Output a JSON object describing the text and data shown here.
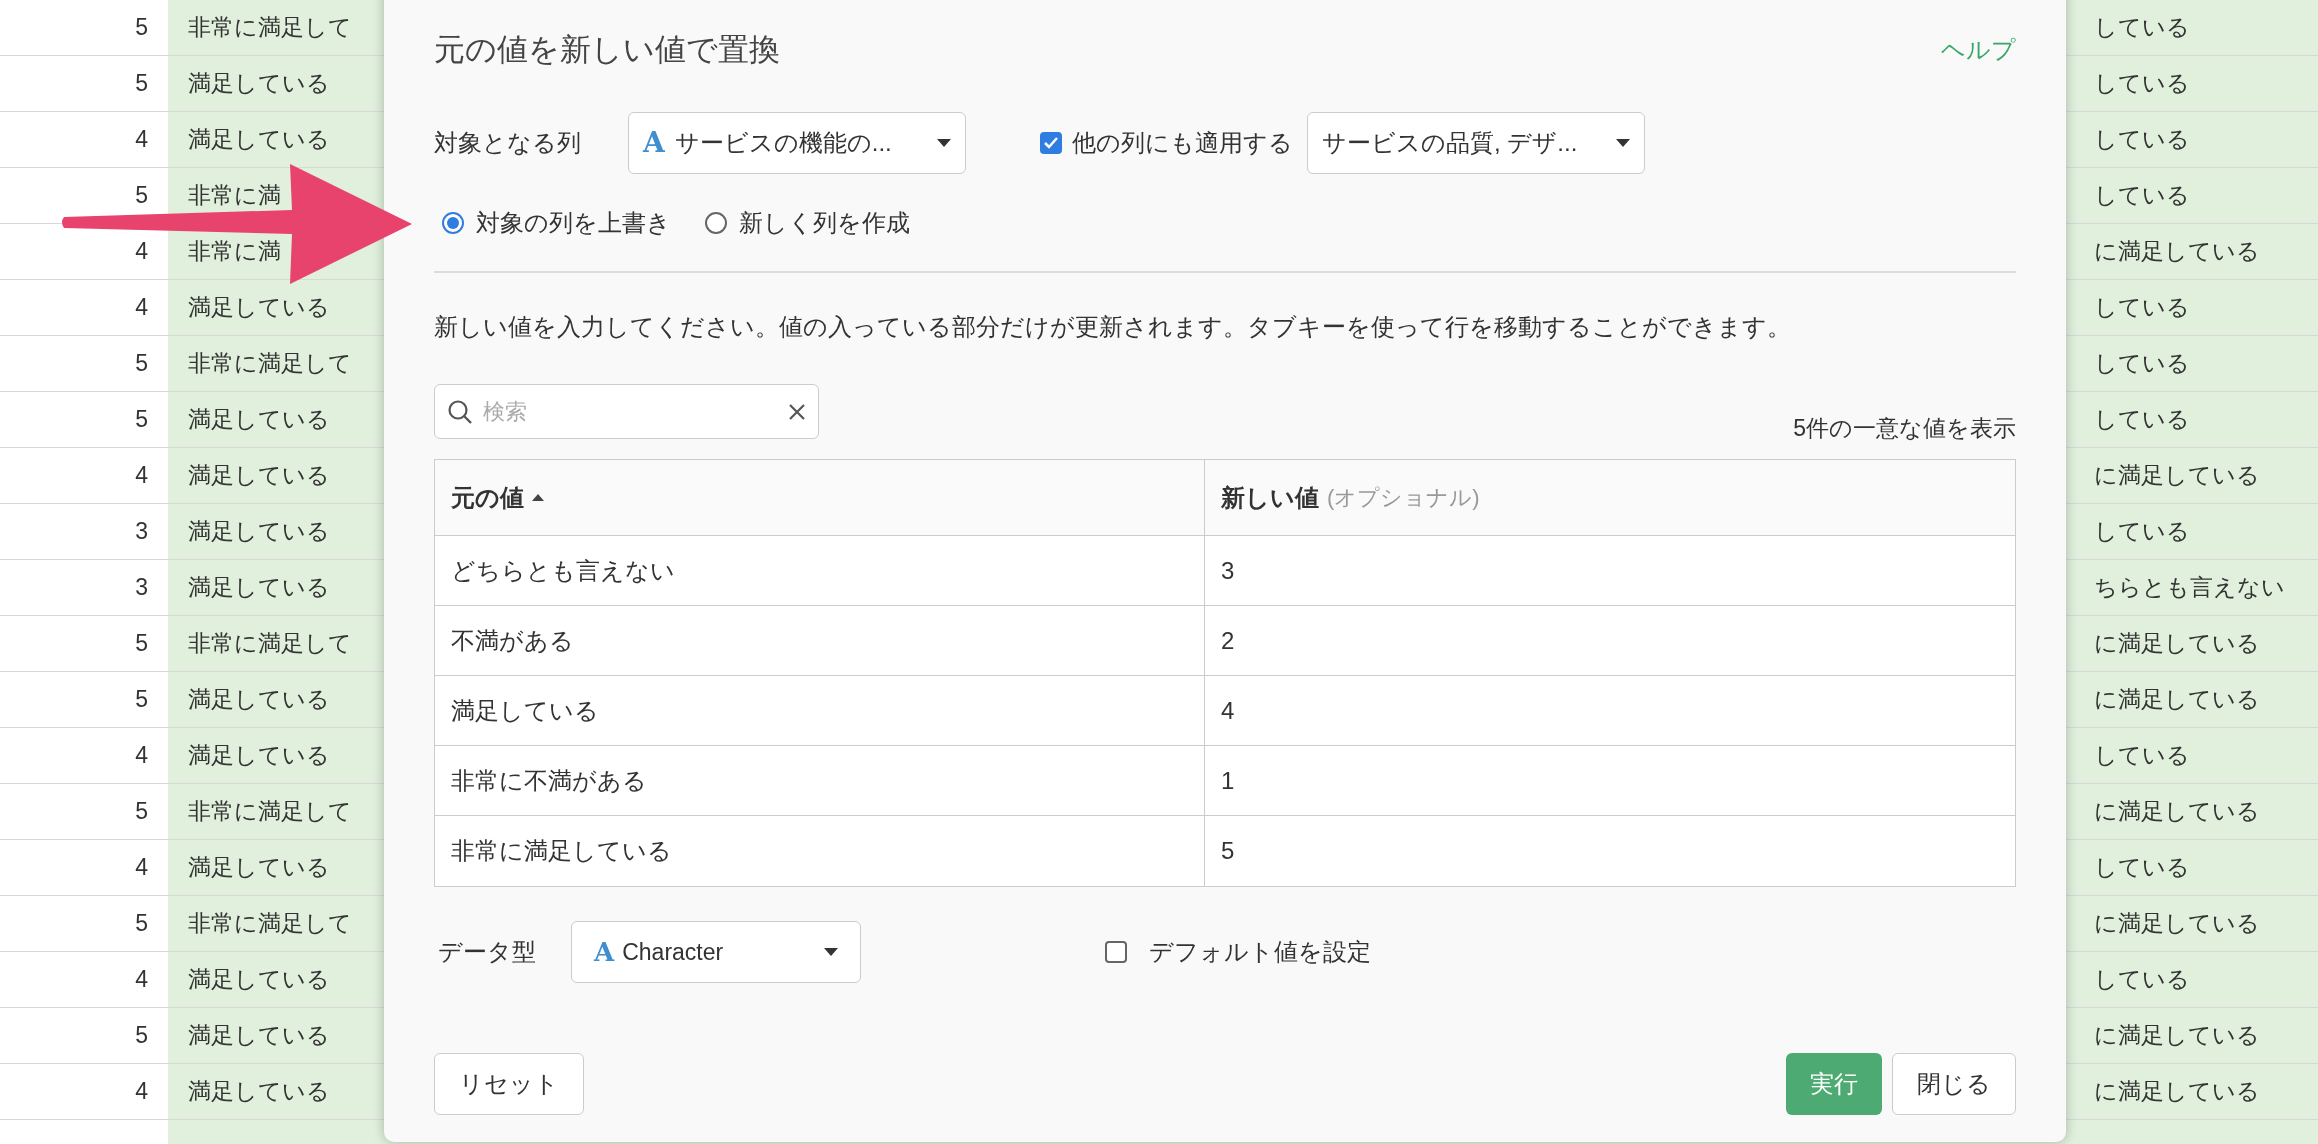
{
  "sheet": {
    "rows": [
      {
        "number": "5",
        "left_text": "非常に満足して",
        "right_text": "している"
      },
      {
        "number": "5",
        "left_text": "満足している",
        "right_text": "している"
      },
      {
        "number": "4",
        "left_text": "満足している",
        "right_text": "している"
      },
      {
        "number": "5",
        "left_text": "非常に満",
        "right_text": "している"
      },
      {
        "number": "4",
        "left_text": "非常に満",
        "right_text": "に満足している"
      },
      {
        "number": "4",
        "left_text": "満足している",
        "right_text": "している"
      },
      {
        "number": "5",
        "left_text": "非常に満足して",
        "right_text": "している"
      },
      {
        "number": "5",
        "left_text": "満足している",
        "right_text": "している"
      },
      {
        "number": "4",
        "left_text": "満足している",
        "right_text": "に満足している"
      },
      {
        "number": "3",
        "left_text": "満足している",
        "right_text": "している"
      },
      {
        "number": "3",
        "left_text": "満足している",
        "right_text": "ちらとも言えない"
      },
      {
        "number": "5",
        "left_text": "非常に満足して",
        "right_text": "に満足している"
      },
      {
        "number": "5",
        "left_text": "満足している",
        "right_text": "に満足している"
      },
      {
        "number": "4",
        "left_text": "満足している",
        "right_text": "している"
      },
      {
        "number": "5",
        "left_text": "非常に満足して",
        "right_text": "に満足している"
      },
      {
        "number": "4",
        "left_text": "満足している",
        "right_text": "している"
      },
      {
        "number": "5",
        "left_text": "非常に満足して",
        "right_text": "に満足している"
      },
      {
        "number": "4",
        "left_text": "満足している",
        "right_text": "している"
      },
      {
        "number": "5",
        "left_text": "満足している",
        "right_text": "に満足している"
      },
      {
        "number": "4",
        "left_text": "満足している",
        "right_text": "に満足している"
      }
    ]
  },
  "dialog": {
    "title": "元の値を新しい値で置換",
    "help_link": "ヘルプ",
    "target_column": {
      "label": "対象となる列",
      "type_icon": "A",
      "value": "サービスの機能の..."
    },
    "apply_other": {
      "label": "他の列にも適用する",
      "checked": true,
      "value": "サービスの品質, デザ..."
    },
    "modes": [
      {
        "label": "対象の列を上書き",
        "selected": true
      },
      {
        "label": "新しく列を作成",
        "selected": false
      }
    ],
    "instruction": "新しい値を入力してください。値の入っている部分だけが更新されます。タブキーを使って行を移動することができます。",
    "search": {
      "placeholder": "検索"
    },
    "count": "5件の一意な値を表示",
    "table": {
      "columns": [
        {
          "label": "元の値",
          "sorted": true
        },
        {
          "label": "新しい値",
          "note": "(オプショナル)",
          "sorted": false
        }
      ],
      "rows": [
        {
          "original": "どちらとも言えない",
          "new": "3"
        },
        {
          "original": "不満がある",
          "new": "2"
        },
        {
          "original": "満足している",
          "new": "4"
        },
        {
          "original": "非常に不満がある",
          "new": "1"
        },
        {
          "original": "非常に満足している",
          "new": "5"
        }
      ]
    },
    "data_type": {
      "label": "データ型",
      "type_icon": "A",
      "value": "Character"
    },
    "default_value": {
      "label": "デフォルト値を設定",
      "checked": false
    },
    "buttons": {
      "reset": "リセット",
      "run": "実行",
      "close": "閉じる"
    }
  }
}
